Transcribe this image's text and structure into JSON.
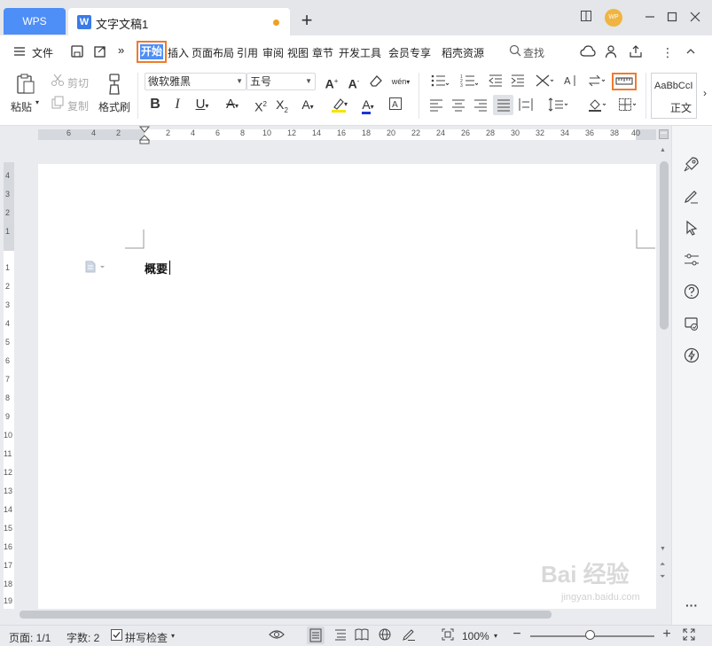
{
  "titlebar": {
    "wps_tab": "WPS",
    "doc_tab": "文字文稿1",
    "new_tab": "+",
    "avatar_text": "WP"
  },
  "menu": {
    "file": "文件",
    "tabs": [
      "开始",
      "插入",
      "页面布局",
      "引用",
      "审阅",
      "视图",
      "章节",
      "开发工具",
      "会员专享",
      "稻壳资源"
    ],
    "search": "查找"
  },
  "ribbon": {
    "paste": "粘贴",
    "cut": "剪切",
    "copy": "复制",
    "format_painter": "格式刷",
    "font_name": "微软雅黑",
    "font_size": "五号",
    "style_preview": "AaBbCcI",
    "style_name": "正文"
  },
  "ruler": {
    "horizontal_numbers": [
      "6",
      "4",
      "2",
      "2",
      "4",
      "6",
      "8",
      "10",
      "12",
      "14",
      "16",
      "18",
      "20",
      "22",
      "24",
      "26",
      "28",
      "30",
      "32",
      "34",
      "36",
      "38",
      "40"
    ],
    "vertical_numbers_top": [
      "4",
      "3",
      "2",
      "1"
    ],
    "vertical_numbers_body": [
      "1",
      "2",
      "3",
      "4",
      "5",
      "6",
      "7",
      "8",
      "9",
      "10",
      "11",
      "12",
      "13",
      "14",
      "15",
      "16",
      "17",
      "18",
      "19"
    ]
  },
  "document": {
    "text": "概要"
  },
  "status": {
    "page": "页面: 1/1",
    "words": "字数: 2",
    "spellcheck": "拼写检查",
    "zoom": "100%"
  },
  "watermark": {
    "main": "Bai 经验",
    "sub": "jingyan.baidu.com"
  }
}
